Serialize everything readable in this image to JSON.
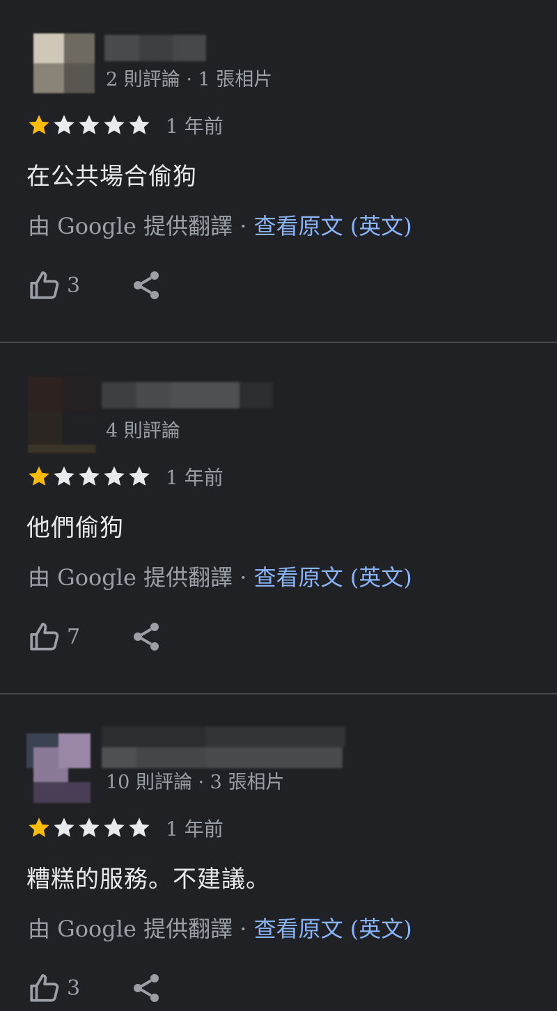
{
  "reviews": [
    {
      "meta": "2 則評論 · 1 張相片",
      "rating": 1,
      "max_rating": 5,
      "time": "1 年前",
      "text": "在公共場合偷狗",
      "translation_prefix": "由 Google 提供翻譯 · ",
      "view_original": "查看原文",
      "original_language": " (英文)",
      "likes": "3",
      "avatar_colors": [
        "#cfc8b8",
        "#6f6a60",
        "#8a8478",
        "#5a5650"
      ]
    },
    {
      "meta": "4 則評論",
      "rating": 1,
      "max_rating": 5,
      "time": "1 年前",
      "text": "他們偷狗",
      "translation_prefix": "由 Google 提供翻譯 · ",
      "view_original": "查看原文",
      "original_language": " (英文)",
      "likes": "7",
      "avatar_colors": [
        "#2e2220",
        "#252021",
        "#2b2622",
        "#3a3428"
      ]
    },
    {
      "meta": "10 則評論 · 3 張相片",
      "rating": 1,
      "max_rating": 5,
      "time": "1 年前",
      "text": "糟糕的服務。不建議。",
      "translation_prefix": "由 Google 提供翻譯 · ",
      "view_original": "查看原文",
      "original_language": " (英文)",
      "likes": "3",
      "avatar_colors": [
        "#3b4252",
        "#8a7a98",
        "#9a86a6",
        "#4a3e56"
      ]
    }
  ],
  "colors": {
    "background": "#202124",
    "star_filled": "#fbbc04",
    "star_empty": "#e8eaed",
    "link": "#8ab4f8",
    "muted_text": "#9aa0a6",
    "divider": "#4a4c50"
  },
  "icons": {
    "star": "star-icon",
    "like": "thumbs-up-icon",
    "share": "share-icon"
  }
}
